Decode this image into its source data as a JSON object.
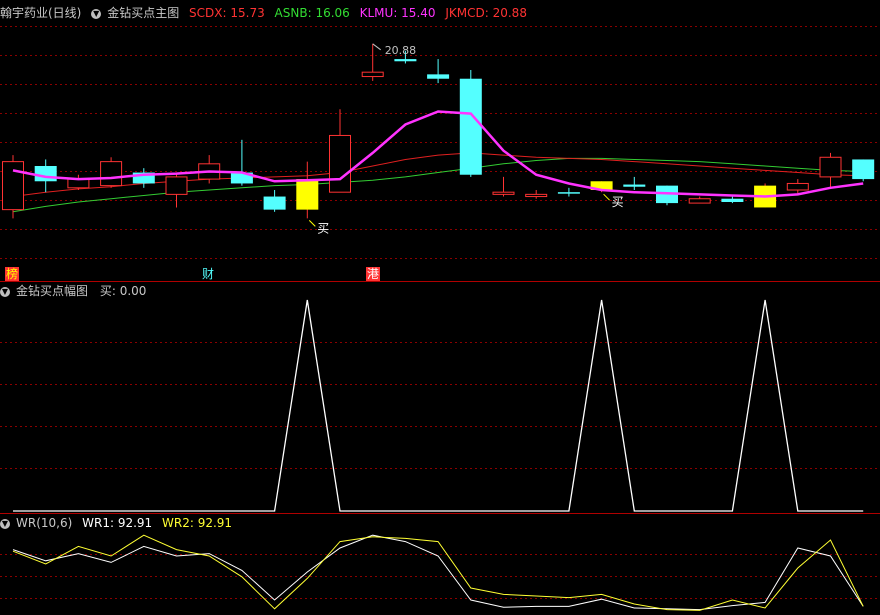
{
  "colors": {
    "up": "#ff3333",
    "down": "#54ffff",
    "buy": "#ffff00",
    "ma_magenta": "#ff33ff",
    "ma_red": "#e02020",
    "ma_green": "#33cc33",
    "grid": "#8b0000",
    "sep": "#b00000",
    "wr1": "#ffffff",
    "wr2": "#ffff33"
  },
  "main_panel": {
    "title": "翰宇药业(日线)",
    "indicator": "金钻买点主图",
    "values": [
      {
        "label": "SCDX: 15.73",
        "color": "#ff3333"
      },
      {
        "label": "ASNB: 16.06",
        "color": "#33dd33"
      },
      {
        "label": "KLMU: 15.40",
        "color": "#ff33ff"
      },
      {
        "label": "JKMCD: 20.88",
        "color": "#ff3333"
      }
    ],
    "high_label": "20.88",
    "buy_label": "买",
    "price_range": [
      11.2,
      22.2
    ],
    "tags": [
      {
        "text": "榜",
        "bg": "#ff3333",
        "fg": "#ffff00"
      },
      {
        "text": "财",
        "bg": "#000000",
        "fg": "#54ffff"
      },
      {
        "text": "港",
        "bg": "#ff3333",
        "fg": "#ffffff"
      }
    ]
  },
  "amp_panel": {
    "indicator": "金钻买点幅图",
    "value_label": "买: 0.00"
  },
  "wr_panel": {
    "indicator": "WR(10,6)",
    "wr1_label": "WR1: 92.91",
    "wr2_label": "WR2: 92.91"
  },
  "chart_data": {
    "type": "candlestick",
    "candles": [
      {
        "o": 13.6,
        "c": 15.8,
        "h": 16.1,
        "l": 13.2,
        "t": "up"
      },
      {
        "o": 15.6,
        "c": 14.9,
        "h": 15.9,
        "l": 14.4,
        "t": "down"
      },
      {
        "o": 14.6,
        "c": 15.0,
        "h": 15.2,
        "l": 14.5,
        "t": "up"
      },
      {
        "o": 14.7,
        "c": 15.8,
        "h": 16.0,
        "l": 14.6,
        "t": "up"
      },
      {
        "o": 15.3,
        "c": 14.8,
        "h": 15.5,
        "l": 14.6,
        "t": "down"
      },
      {
        "o": 14.3,
        "c": 15.1,
        "h": 15.3,
        "l": 13.7,
        "t": "up"
      },
      {
        "o": 15.0,
        "c": 15.7,
        "h": 16.1,
        "l": 14.8,
        "t": "up"
      },
      {
        "o": 15.3,
        "c": 14.8,
        "h": 16.8,
        "l": 14.7,
        "t": "down"
      },
      {
        "o": 14.2,
        "c": 13.6,
        "h": 14.5,
        "l": 13.5,
        "t": "down"
      },
      {
        "o": 15.0,
        "c": 13.6,
        "h": 15.8,
        "l": 13.2,
        "t": "buy"
      },
      {
        "o": 14.4,
        "c": 17.0,
        "h": 18.2,
        "l": 14.4,
        "t": "up"
      },
      {
        "o": 19.7,
        "c": 19.9,
        "h": 21.2,
        "l": 19.5,
        "t": "up"
      },
      {
        "o": 20.5,
        "c": 20.4,
        "h": 20.88,
        "l": 20.3,
        "t": "down"
      },
      {
        "o": 19.8,
        "c": 19.6,
        "h": 20.5,
        "l": 19.4,
        "t": "down"
      },
      {
        "o": 19.6,
        "c": 15.2,
        "h": 20.0,
        "l": 15.1,
        "t": "down"
      },
      {
        "o": 14.3,
        "c": 14.4,
        "h": 15.1,
        "l": 14.2,
        "t": "up"
      },
      {
        "o": 14.2,
        "c": 14.3,
        "h": 14.5,
        "l": 14.1,
        "t": "up"
      },
      {
        "o": 14.35,
        "c": 14.4,
        "h": 14.6,
        "l": 14.2,
        "t": "down"
      },
      {
        "o": 14.9,
        "c": 14.5,
        "h": 14.9,
        "l": 14.4,
        "t": "buy"
      },
      {
        "o": 14.75,
        "c": 14.65,
        "h": 15.1,
        "l": 14.5,
        "t": "down"
      },
      {
        "o": 14.7,
        "c": 13.9,
        "h": 14.7,
        "l": 13.8,
        "t": "down"
      },
      {
        "o": 13.9,
        "c": 14.1,
        "h": 14.2,
        "l": 13.9,
        "t": "up"
      },
      {
        "o": 14.1,
        "c": 13.95,
        "h": 14.2,
        "l": 13.9,
        "t": "down"
      },
      {
        "o": 14.7,
        "c": 13.7,
        "h": 14.8,
        "l": 13.7,
        "t": "buy"
      },
      {
        "o": 14.5,
        "c": 14.8,
        "h": 15.0,
        "l": 14.3,
        "t": "up"
      },
      {
        "o": 15.1,
        "c": 16.0,
        "h": 16.2,
        "l": 14.6,
        "t": "up"
      },
      {
        "o": 15.9,
        "c": 15.0,
        "h": 15.9,
        "l": 14.9,
        "t": "down"
      }
    ],
    "ma_magenta": [
      15.4,
      15.1,
      15.0,
      15.05,
      15.2,
      15.25,
      15.35,
      15.3,
      14.9,
      14.95,
      15.0,
      16.2,
      17.5,
      18.1,
      18.0,
      16.3,
      15.2,
      14.8,
      14.5,
      14.4,
      14.35,
      14.3,
      14.25,
      14.2,
      14.3,
      14.6,
      14.8
    ],
    "ma_red": [
      14.2,
      14.4,
      14.55,
      14.65,
      14.8,
      14.9,
      15.0,
      15.05,
      15.1,
      15.15,
      15.3,
      15.6,
      15.9,
      16.1,
      16.2,
      16.1,
      16.0,
      15.95,
      15.9,
      15.8,
      15.7,
      15.6,
      15.5,
      15.4,
      15.3,
      15.2,
      15.15
    ],
    "ma_green": [
      13.5,
      13.75,
      13.95,
      14.1,
      14.25,
      14.4,
      14.5,
      14.6,
      14.7,
      14.75,
      14.85,
      14.95,
      15.1,
      15.3,
      15.5,
      15.7,
      15.85,
      15.95,
      15.95,
      15.9,
      15.85,
      15.8,
      15.7,
      15.6,
      15.5,
      15.4,
      15.35
    ],
    "amplitude": {
      "range": [
        0,
        1
      ],
      "points": [
        [
          0,
          0
        ],
        [
          8,
          0
        ],
        [
          9,
          1
        ],
        [
          10,
          0
        ],
        [
          17,
          0
        ],
        [
          18,
          1
        ],
        [
          19,
          0
        ],
        [
          22,
          0
        ],
        [
          23,
          1
        ],
        [
          24,
          0
        ],
        [
          26,
          0
        ]
      ]
    },
    "wr": {
      "range": [
        0,
        100
      ],
      "wr1": [
        22,
        36,
        27,
        38,
        18,
        30,
        27,
        48,
        85,
        50,
        20,
        4,
        12,
        30,
        85,
        94,
        93,
        93,
        84,
        95,
        96,
        97,
        92,
        88,
        20,
        30,
        93
      ],
      "wr2": [
        24,
        40,
        18,
        30,
        4,
        22,
        30,
        56,
        96,
        58,
        12,
        6,
        8,
        12,
        70,
        78,
        80,
        82,
        78,
        90,
        97,
        98,
        85,
        95,
        45,
        10,
        93
      ]
    }
  }
}
